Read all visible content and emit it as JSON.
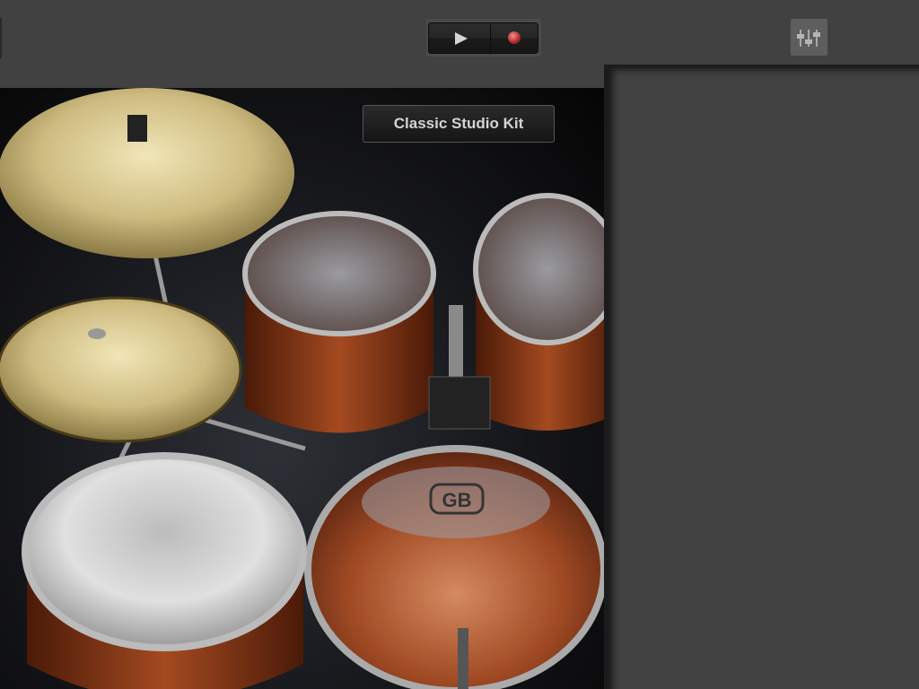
{
  "toolbar": {
    "play_icon": "play-icon",
    "record_icon": "record-icon",
    "mixer_icon": "mixer-sliders-icon"
  },
  "drum_kit": {
    "kit_name": "Classic Studio Kit",
    "kick_logo": "GB"
  },
  "colors": {
    "background": "#414141",
    "record": "#b02828",
    "drum_shell": "#8a3a18",
    "cymbal": "#d4c48a"
  }
}
